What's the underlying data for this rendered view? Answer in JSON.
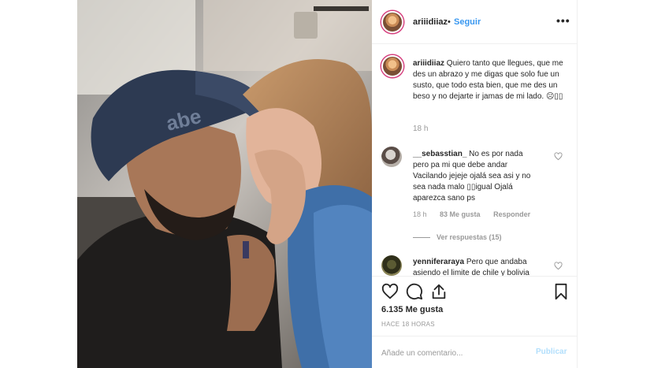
{
  "post": {
    "username": "ariiidiiaz",
    "dot": "•",
    "follow_label": "Seguir",
    "more_label": "•••"
  },
  "caption": {
    "username": "ariiidiiaz",
    "text": " Quiero tanto que llegues, que me des un abrazo y me digas que solo fue un susto, que todo esta bien, que me des un beso y no dejarte ir jamas de mi lado. ☹▯▯",
    "time": "18 h"
  },
  "comments": [
    {
      "username": "__sebasstian_",
      "text": " No es por nada pero pa mi que debe andar Vacilando jejeje ojalá sea asi y no sea nada malo ▯▯igual Ojalá aparezca sano ps",
      "time": "18 h",
      "likes": "83 Me gusta",
      "reply": "Responder",
      "view_replies": "Ver respuestas (15)"
    },
    {
      "username": "yenniferaraya",
      "text": " Pero que andaba asiendo el limite de chile y bolivia"
    }
  ],
  "actions": {
    "likes": "6.135 Me gusta",
    "ago": "HACE 18 HORAS"
  },
  "add_comment": {
    "placeholder": "Añade un comentario...",
    "publish": "Publicar"
  },
  "icons": {
    "like": "heart-icon",
    "comment": "comment-icon",
    "share": "share-icon",
    "save": "bookmark-icon",
    "more": "more-icon"
  },
  "colors": {
    "link": "#3897f0",
    "publish_disabled": "#b2dffc",
    "meta": "#999999",
    "divider": "#efefef"
  }
}
